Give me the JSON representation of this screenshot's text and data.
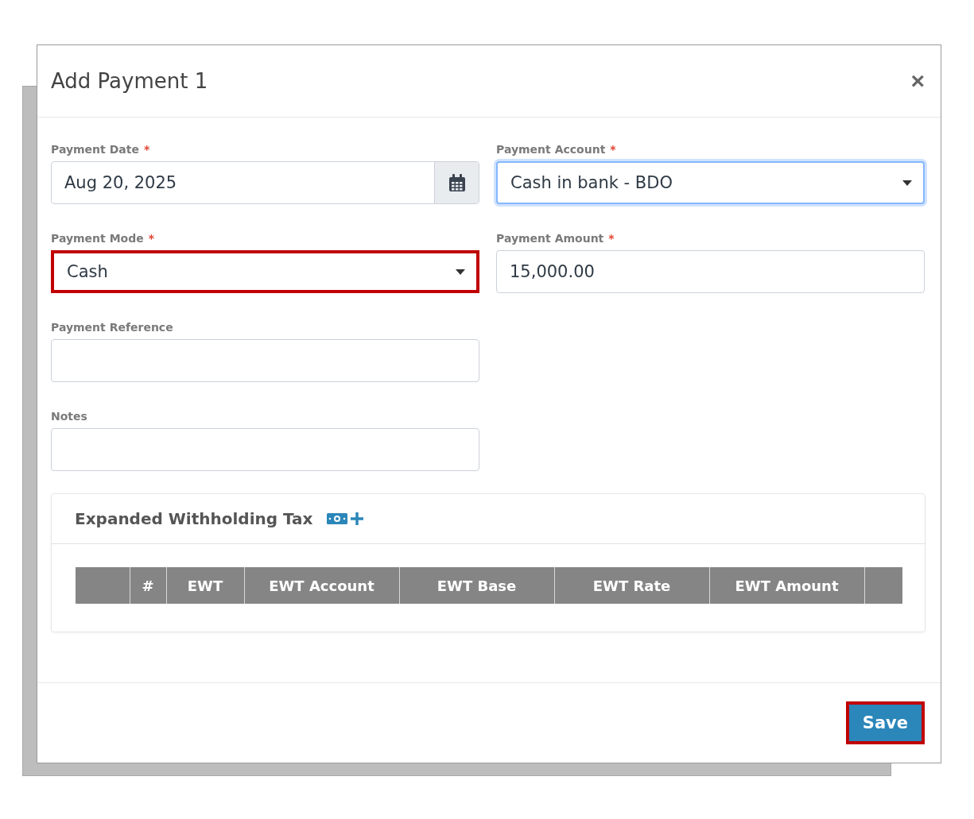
{
  "dialog": {
    "title": "Add Payment 1",
    "close_label": "×"
  },
  "fields": [
    {
      "label": "Payment Date",
      "required_mark": "*",
      "kind": "date",
      "value": "Aug 20, 2025",
      "focused": false,
      "highlighted": false
    },
    {
      "label": "Payment Account",
      "required_mark": "*",
      "kind": "select",
      "value": "Cash in bank - BDO",
      "focused": true,
      "highlighted": false
    },
    {
      "label": "Payment Mode",
      "required_mark": "*",
      "kind": "select",
      "value": "Cash",
      "focused": false,
      "highlighted": true
    },
    {
      "label": "Payment Amount",
      "required_mark": "*",
      "kind": "input",
      "value": "15,000.00",
      "focused": false,
      "highlighted": false
    },
    {
      "label": "Payment Reference",
      "kind": "input",
      "focused": false,
      "highlighted": false
    },
    {
      "label": "Notes",
      "kind": "input",
      "focused": false,
      "highlighted": false
    }
  ],
  "ewt": {
    "title": "Expanded Withholding Tax",
    "columns": [
      "",
      "#",
      "EWT",
      "EWT Account",
      "EWT Base",
      "EWT Rate",
      "EWT Amount",
      ""
    ]
  },
  "footer": {
    "save_label": "Save",
    "save_highlighted": true
  }
}
